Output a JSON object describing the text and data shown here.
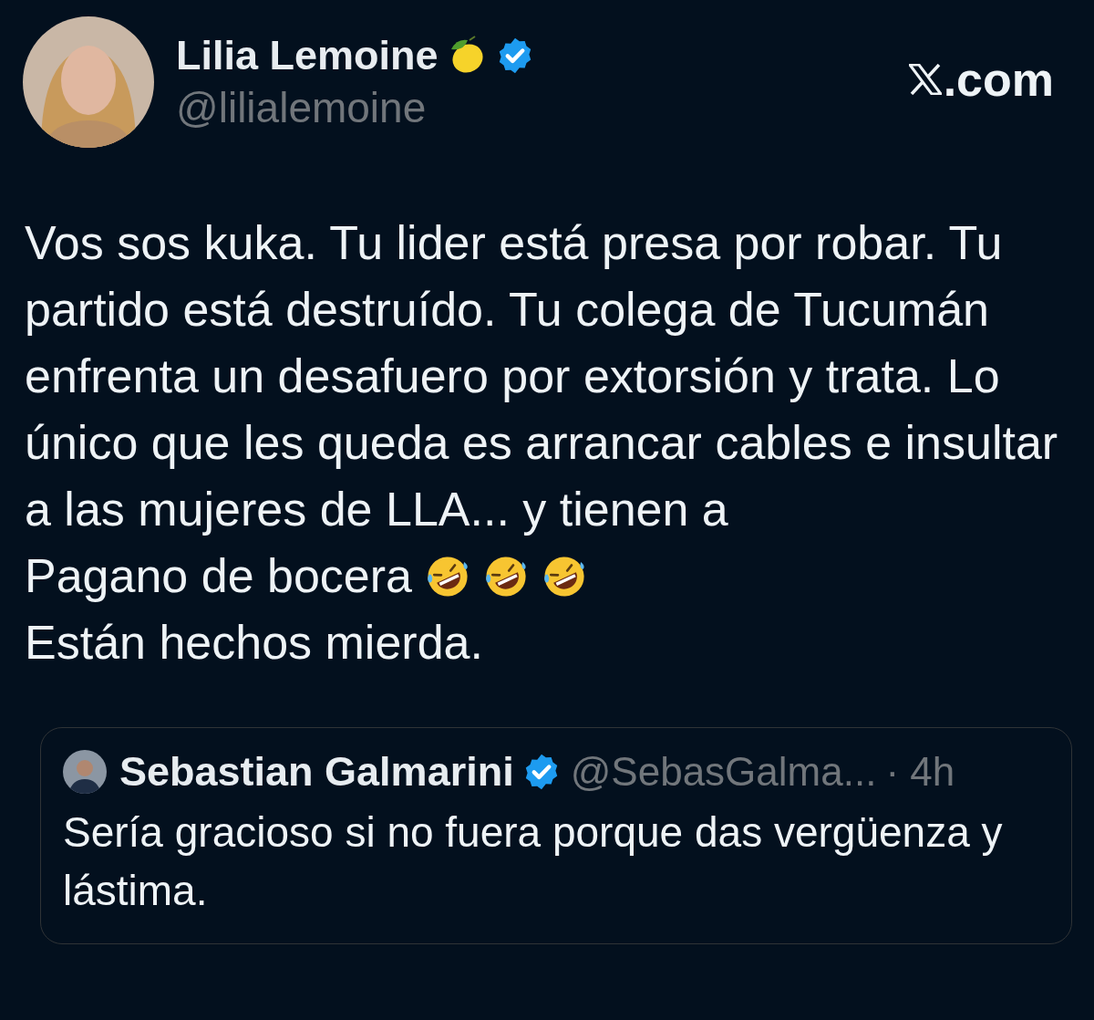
{
  "author": {
    "name": "Lilia Lemoine",
    "handle": "@lilialemoine",
    "verified": true
  },
  "brand": {
    "text": ".com"
  },
  "body": [
    {
      "text": "Vos sos kuka. Tu lider está presa por robar. Tu partido está destruído. Tu colega de Tucumán enfrenta un desafuero por extorsión y trata. Lo único que les queda es arrancar cables e insultar a las mujeres de LLA... y tienen a"
    },
    {
      "text": "Pagano de bocera",
      "emojis": [
        {
          "kind": "laughing"
        },
        {
          "kind": "laughing"
        },
        {
          "kind": "laughing"
        }
      ]
    },
    {
      "text": "Están hechos mierda."
    }
  ],
  "quote": {
    "name": "Sebastian Galmarini",
    "verified": true,
    "handle": "@SebasGalma...",
    "time": "· 4h",
    "text": "Sería gracioso si no fuera porque das vergüenza y lástima."
  }
}
